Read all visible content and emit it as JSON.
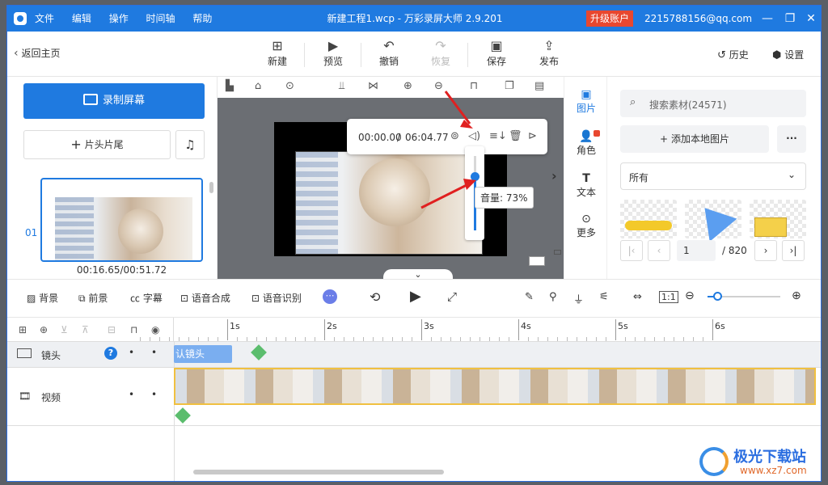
{
  "titlebar": {
    "menu": [
      "文件",
      "编辑",
      "操作",
      "时间轴",
      "帮助"
    ],
    "title": "新建工程1.wcp - 万彩录屏大师 2.9.201",
    "upgrade": "升级账户",
    "email": "2215788156@qq.com",
    "minimize": "—",
    "restore": "❐",
    "close": "✕"
  },
  "toolbar": {
    "back": "返回主页",
    "new": "新建",
    "preview": "预览",
    "undo": "撤销",
    "redo": "恢复",
    "save": "保存",
    "publish": "发布",
    "history": "历史",
    "settings": "设置"
  },
  "left": {
    "record": "录制屏幕",
    "intro": "片头片尾",
    "scene_index": "01",
    "scene_time": "00:16.65/00:51.72"
  },
  "player": {
    "current": "00:00.00",
    "sep": "/",
    "total": "06:04.77",
    "volume_label": "音量: 73%",
    "volume": 0.73
  },
  "sidetabs": [
    "图片",
    "角色",
    "文本",
    "更多"
  ],
  "right": {
    "search_placeholder": "搜索素材(24571)",
    "add_local": "添加本地图片",
    "more": "···",
    "filter": "所有",
    "page": "1",
    "total_pages": "/ 820"
  },
  "bottom": {
    "bg": "背景",
    "fg": "前景",
    "subtitle": "字幕",
    "tts": "语音合成",
    "asr": "语音识别",
    "zoom_level": 0.13
  },
  "timeline": {
    "ticks": [
      "1s",
      "2s",
      "3s",
      "4s",
      "5s",
      "6s"
    ],
    "track_camera": "镜头",
    "camera_clip": "认镜头",
    "track_video": "视频"
  },
  "watermark": {
    "brand": "极光下载站",
    "url": "www.xz7.com"
  }
}
